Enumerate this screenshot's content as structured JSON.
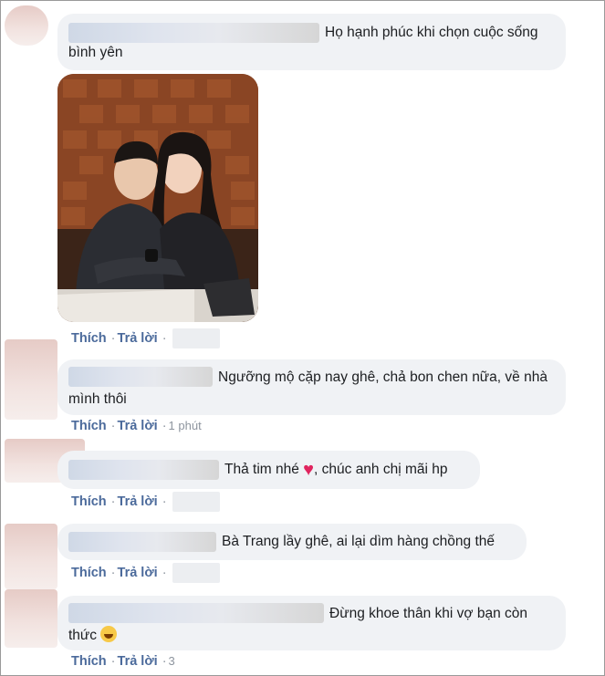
{
  "actions": {
    "like_label": "Thích",
    "reply_label": "Trả lời",
    "separator": "·"
  },
  "comments": [
    {
      "text": "Họ hạnh phúc khi chọn cuộc sống bình yên",
      "time": ""
    },
    {
      "text": "Ngưỡng mộ cặp nay ghê, chả bon chen nữa, về nhà mình thôi",
      "time": "1 phút"
    },
    {
      "text_before": "Thả tim nhé ",
      "text_after": ", chúc anh chị mãi hp",
      "emoji": "heart-emoji",
      "time": ""
    },
    {
      "text": "Bà Trang lầy ghê, ai lại dìm hàng chồng thế",
      "time": ""
    },
    {
      "text": "Đừng khoe thân khi vợ bạn còn thức",
      "emoji": "laughing-emoji",
      "time": "3"
    }
  ]
}
